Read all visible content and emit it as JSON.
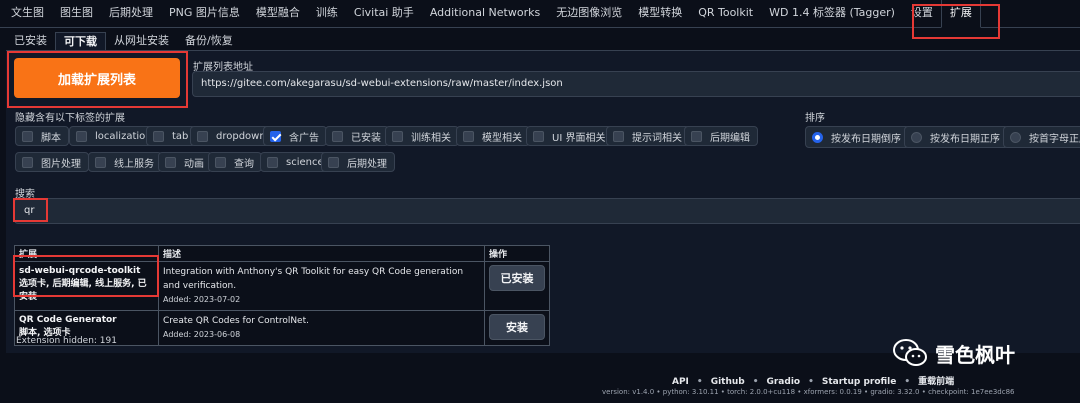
{
  "top_tabs": [
    "文生图",
    "图生图",
    "后期处理",
    "PNG 图片信息",
    "模型融合",
    "训练",
    "Civitai 助手",
    "Additional Networks",
    "无边图像浏览",
    "模型转换",
    "QR Toolkit",
    "WD 1.4 标签器 (Tagger)",
    "设置",
    "扩展"
  ],
  "sub_tabs": [
    "已安装",
    "可下载",
    "从网址安装",
    "备份/恢复"
  ],
  "load_button": "加载扩展列表",
  "url_label": "扩展列表地址",
  "url_value": "https://gitee.com/akegarasu/sd-webui-extensions/raw/master/index.json",
  "hide_label": "隐藏含有以下标签的扩展",
  "tags_row1": [
    "脚本",
    "localization",
    "tab",
    "dropdown",
    "含广告",
    "已安装",
    "训练相关",
    "模型相关",
    "UI 界面相关",
    "提示词相关",
    "后期编辑"
  ],
  "tags_row2": [
    "图片处理",
    "线上服务",
    "动画",
    "查询",
    "science",
    "后期处理"
  ],
  "checked_tag": "含广告",
  "sort_label": "排序",
  "sort_options": [
    "按发布日期倒序",
    "按发布日期正序",
    "按首字母正序"
  ],
  "sort_selected": "按发布日期倒序",
  "search_label": "搜索",
  "search_value": "qr",
  "table": {
    "headers": [
      "扩展",
      "描述",
      "操作"
    ],
    "rows": [
      {
        "name": "sd-webui-qrcode-toolkit",
        "tags": "选项卡, 后期编辑, 线上服务, 已安装",
        "desc": "Integration with Anthony's QR Toolkit for easy QR Code generation and verification.",
        "added": "Added: 2023-07-02",
        "action": "已安装"
      },
      {
        "name": "QR Code Generator",
        "tags": "脚本, 选项卡",
        "desc": "Create QR Codes for ControlNet.",
        "added": "Added: 2023-06-08",
        "action": "安装"
      }
    ]
  },
  "hidden_count": "Extension hidden: 191",
  "footer_links": [
    "API",
    "Github",
    "Gradio",
    "Startup profile",
    "重载前端"
  ],
  "version_line": "version: v1.4.0  •  python: 3.10.11  •  torch: 2.0.0+cu118  •  xformers: 0.0.19  •  gradio: 3.32.0  •  checkpoint: 1e7ee3dc86",
  "watermark": "雪色枫叶",
  "colors": {
    "accent": "#f97316",
    "highlight": "#e53935",
    "check": "#2563eb"
  }
}
